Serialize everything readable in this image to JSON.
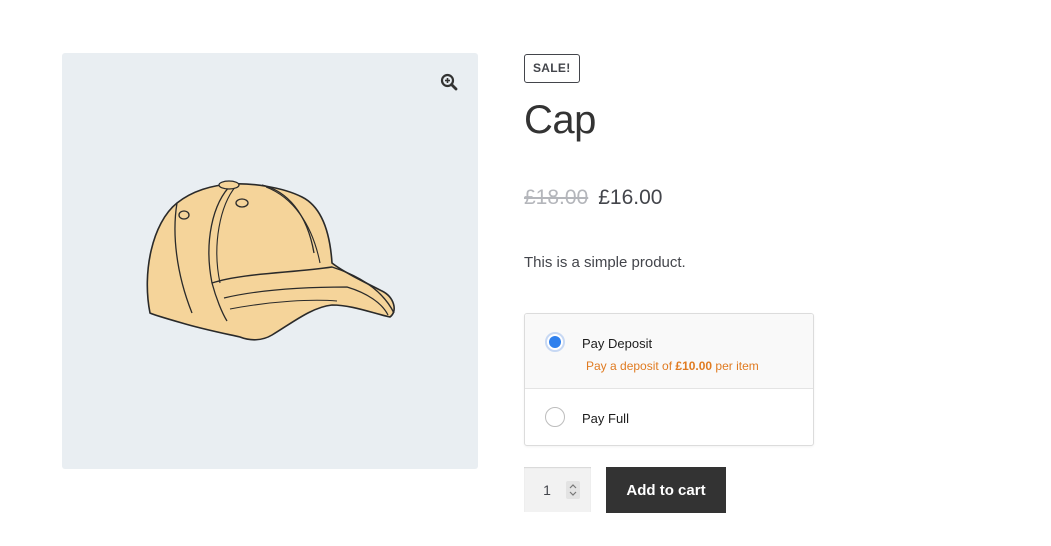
{
  "product": {
    "sale_badge": "Sale!",
    "title": "Cap",
    "price_regular": "£18.00",
    "price_sale": "£16.00",
    "short_description": "This is a simple product.",
    "image_alt": "Cap"
  },
  "deposit_options": {
    "pay_deposit_label": "Pay Deposit",
    "pay_deposit_note_prefix": "Pay a deposit of ",
    "pay_deposit_amount": "£10.00",
    "pay_deposit_note_suffix": " per item",
    "pay_full_label": "Pay Full",
    "selected": "pay_deposit"
  },
  "cart": {
    "quantity": "1",
    "add_to_cart_label": "Add to cart"
  },
  "icons": {
    "zoom": "zoom-in-icon",
    "quantity_spinner": "spinner-icon"
  },
  "colors": {
    "gallery_bg": "#e9eef2",
    "accent_radio": "#2f80ed",
    "deposit_note": "#e07b21",
    "button_bg": "#333333"
  }
}
